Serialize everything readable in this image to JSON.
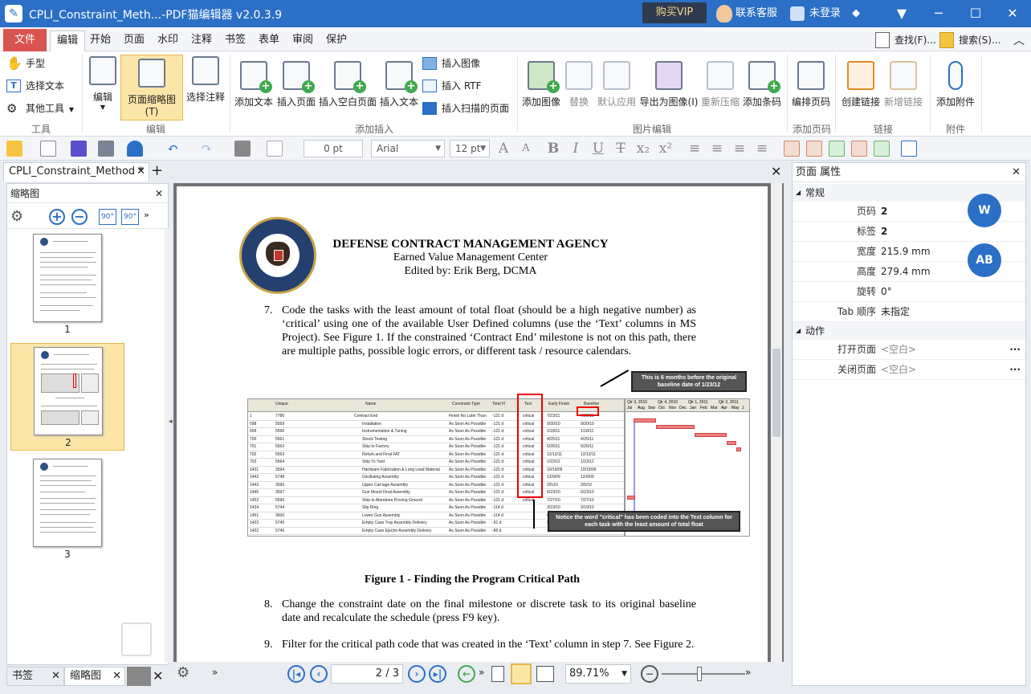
{
  "app": {
    "title": "CPLI_Constraint_Meth...-PDF猫编辑器 v2.0.3.9",
    "vip_label": "购买VIP",
    "service_label": "联系客服",
    "login_label": "未登录"
  },
  "menu": {
    "file": "文件",
    "tabs": [
      "编辑",
      "开始",
      "页面",
      "水印",
      "注释",
      "书签",
      "表单",
      "审阅",
      "保护"
    ],
    "find": "查找(F)...",
    "search": "搜索(S)..."
  },
  "ribbon": {
    "tools": {
      "hand": "手型",
      "select_text": "选择文本",
      "other_tools": "其他工具",
      "group": "工具"
    },
    "edit": {
      "edit": "编辑",
      "thumbnail_view": "页面缩略图(T)",
      "select_annotation": "选择注释",
      "group": "编辑"
    },
    "add_insert": {
      "add_text": "添加文本",
      "insert_page": "插入页面",
      "insert_blank": "插入空白页面",
      "insert_text": "插入文本",
      "insert_image": "插入图像",
      "insert_rtf": "插入 RTF",
      "insert_scanned": "插入扫描的页面",
      "group": "添加插入"
    },
    "image_edit": {
      "add_image": "添加图像",
      "replace": "替换",
      "default_apply": "默认应用",
      "export_image": "导出为图像(I)",
      "recompress": "重新压缩",
      "add_barcode": "添加条码",
      "group": "图片编辑"
    },
    "page_num": {
      "bates": "编排页码",
      "group": "添加页码"
    },
    "link": {
      "create": "创建链接",
      "new": "新增链接",
      "group": "链接"
    },
    "attach": {
      "add": "添加附件",
      "group": "附件"
    }
  },
  "format_bar": {
    "line_width": "0 pt",
    "font": "Arial",
    "font_size": "12 pt"
  },
  "doc_tab": {
    "name": "CPLI_Constraint_Method *"
  },
  "left_panel": {
    "title": "缩略图",
    "pages": [
      "1",
      "2",
      "3"
    ],
    "selected_page": "2",
    "bottom_tabs": [
      "书签",
      "缩略图"
    ]
  },
  "document": {
    "agency_line1": "DEFENSE CONTRACT MANAGEMENT AGENCY",
    "agency_line2": "Earned Value Management Center",
    "agency_line3": "Edited by: Erik Berg, DCMA",
    "item7_num": "7.",
    "item7": "Code the tasks with the least amount of total float (should be a high negative number) as ‘critical’ using one of the available User Defined columns (use the ‘Text’ columns in MS Project). See Figure 1.   If the constrained ‘Contract End’ milestone is not on this path, there are multiple paths, possible logic errors, or different task / resource calendars.",
    "callout_top": "This is 6 months before the original baseline date of 1/23/12",
    "callout_bottom": "Notice the word \"critical\" has been coded into the Text column for each task with the least amount of total float",
    "figure_caption": "Figure 1 - Finding the Program Critical Path",
    "item8_num": "8.",
    "item8": "Change the constraint date on the final milestone or discrete task to its original baseline date and recalculate the schedule (press F9 key).",
    "item9_num": "9.",
    "item9": "Filter for the critical path code that was created in the ‘Text’ column in step 7. See Figure 2.",
    "table_headers": [
      "Unique",
      "Name",
      "Constraint Type",
      "Total Fl",
      "Text",
      "Early Finish",
      "Baseline"
    ],
    "gantt_headers": [
      "Qtr 3, 2010",
      "Qtr 4, 2010",
      "Qtr 1, 2011",
      "Qtr 2, 2011"
    ],
    "gantt_months": [
      "Jul",
      "Aug",
      "Sep",
      "Oct",
      "Nov",
      "Dec",
      "Jan",
      "Feb",
      "Mar",
      "Apr",
      "May",
      "J"
    ],
    "table_rows": [
      [
        "1",
        "7786",
        "Contract End",
        "Finish No Later Than",
        "-121 d",
        "critical",
        "7/23/11",
        "7/23/11"
      ],
      [
        "698",
        "5559",
        "Installation",
        "As Soon As Possible",
        "-121 d",
        "critical",
        "9/30/10",
        "9/30/10"
      ],
      [
        "699",
        "5560",
        "Instrumentation & Tuning",
        "As Soon As Possible",
        "-121 d",
        "critical",
        "1/18/11",
        "1/18/11"
      ],
      [
        "700",
        "5561",
        "Shock Testing",
        "As Soon As Possible",
        "-121 d",
        "critical",
        "4/25/11",
        "4/25/11"
      ],
      [
        "701",
        "5562",
        "Ship to Factory",
        "As Soon As Possible",
        "-121 d",
        "critical",
        "5/26/11",
        "5/26/11"
      ],
      [
        "702",
        "5563",
        "Refurb and Final FAT",
        "As Soon As Possible",
        "-121 d",
        "critical",
        "12/12/11",
        "12/12/11"
      ],
      [
        "703",
        "5564",
        "Ship To Yard",
        "As Soon As Possible",
        "-121 d",
        "critical",
        "1/23/12",
        "1/23/12"
      ],
      [
        "1431",
        "3594",
        "Hardware Fabrication & Long Lead Material",
        "As Soon As Possible",
        "-121 d",
        "critical",
        "10/19/09",
        "10/19/09"
      ],
      [
        "1442",
        "5748",
        "Oscillating Assembly",
        "As Soon As Possible",
        "-121 d",
        "critical",
        "12/9/09",
        "12/9/09"
      ],
      [
        "1443",
        "3596",
        "Upper Carriage Assembly",
        "As Soon As Possible",
        "-121 d",
        "critical",
        "2/5/10",
        "2/5/10"
      ],
      [
        "1445",
        "3597",
        "Gun Mount Final Assembly",
        "As Soon As Possible",
        "-121 d",
        "critical",
        "6/23/10",
        "6/23/10"
      ],
      [
        "1452",
        "5596",
        "Ship to Aberdeen Proving Ground",
        "As Soon As Possible",
        "-121 d",
        "critical",
        "7/27/10",
        "7/27/10"
      ],
      [
        "1434",
        "5744",
        "Slip Ring",
        "As Soon As Possible",
        "-114 d",
        "",
        "3/19/10",
        "3/19/10"
      ],
      [
        "1451",
        "3600",
        "Lower Gun Assembly",
        "As Soon As Possible",
        "-114 d",
        "",
        "6/14/10",
        "6/14/10"
      ],
      [
        "1433",
        "5745",
        "Empty Case Tray Assembly Delivery",
        "As Soon As Possible",
        "-91 d",
        "",
        "9/8/09",
        "9/8/09"
      ],
      [
        "1432",
        "5746",
        "Empty Case Ejector Assembly Delivery",
        "As Soon As Possible",
        "-86 d",
        "",
        "10/19/09",
        "10/19/09"
      ]
    ]
  },
  "nav": {
    "page_value": "2",
    "page_total": "/ 3",
    "zoom": "89.71%"
  },
  "right_panel": {
    "title": "页面 属性",
    "general": "常规",
    "props": [
      {
        "k": "页码",
        "v": "2"
      },
      {
        "k": "标签",
        "v": "2"
      },
      {
        "k": "宽度",
        "v": "215.9 mm"
      },
      {
        "k": "高度",
        "v": "279.4 mm"
      },
      {
        "k": "旋转",
        "v": "0°"
      },
      {
        "k": "Tab 顺序",
        "v": "未指定"
      }
    ],
    "actions": "动作",
    "open_page": "打开页面",
    "close_page": "关闭页面",
    "empty": "<空白>"
  },
  "colors": {
    "accent": "#2b6fc6",
    "file_tab": "#d9534f",
    "selection": "#fbe6a8",
    "critical_box": "#e00000"
  }
}
